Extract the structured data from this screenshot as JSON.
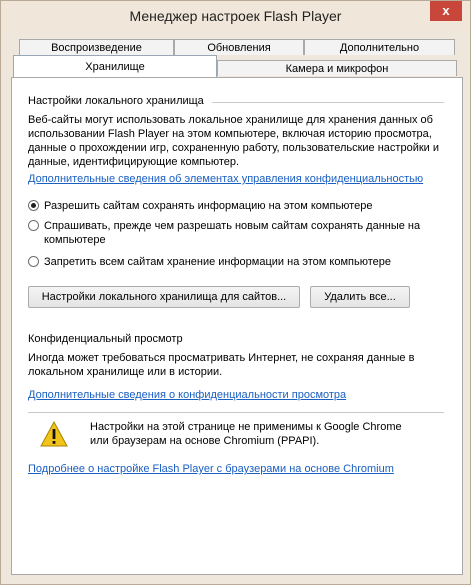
{
  "window": {
    "title": "Менеджер настроек Flash Player",
    "close_label": "x"
  },
  "tabs": {
    "row_top": [
      "Воспроизведение",
      "Обновления",
      "Дополнительно"
    ],
    "row_bottom": [
      "Хранилище",
      "Камера и микрофон"
    ],
    "selected": "Хранилище"
  },
  "local_storage": {
    "title": "Настройки локального хранилища",
    "description": "Веб-сайты могут использовать локальное хранилище для хранения данных об использовании Flash Player на этом компьютере, включая историю просмотра, данные о прохождении игр, сохраненную работу, пользовательские настройки и данные, идентифицирующие компьютер.",
    "privacy_controls_link": "Дополнительные сведения об элементах управления конфиденциальностью",
    "options": [
      {
        "label": "Разрешить сайтам сохранять информацию на этом компьютере",
        "checked": true
      },
      {
        "label": "Спрашивать, прежде чем разрешать новым сайтам сохранять данные на компьютере",
        "checked": false
      },
      {
        "label": "Запретить всем сайтам хранение информации на этом компьютере",
        "checked": false
      }
    ],
    "site_settings_button": "Настройки локального хранилища для сайтов...",
    "delete_all_button": "Удалить все..."
  },
  "private_browsing": {
    "title": "Конфиденциальный просмотр",
    "description": "Иногда может требоваться просматривать Интернет, не сохраняя данные в локальном хранилище или в истории.",
    "link": "Дополнительные сведения о конфиденциальности просмотра"
  },
  "notice": {
    "icon": "warning-icon",
    "text": "Настройки на этой странице не применимы к Google Chrome или браузерам на основе Chromium (PPAPI).",
    "link": "Подробнее о настройке Flash Player с браузерами на основе Chromium"
  },
  "colors": {
    "link": "#1a5fc2",
    "close": "#c8473a",
    "warning": "#f2c318"
  }
}
